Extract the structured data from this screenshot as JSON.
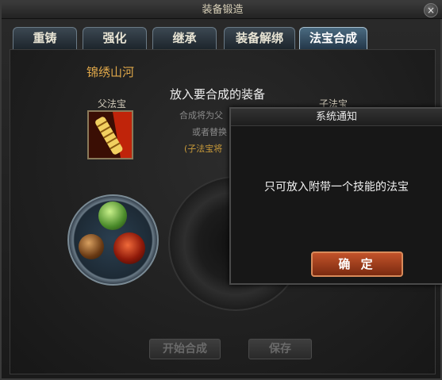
{
  "window": {
    "title": "装备锻造",
    "close_label": "×"
  },
  "tabs": [
    {
      "label": "重铸",
      "active": false
    },
    {
      "label": "强化",
      "active": false
    },
    {
      "label": "继承",
      "active": false
    },
    {
      "label": "装备解绑",
      "active": false
    },
    {
      "label": "法宝合成",
      "active": true
    }
  ],
  "main": {
    "item_name": "锦绣山河",
    "prompt_title": "放入要合成的装备",
    "hint_line1": "合成将为父",
    "hint_line2": "或者替换",
    "hint_line3": "(子法宝将",
    "parent_label": "父法宝",
    "child_label": "子法宝",
    "start_button": "开始合成",
    "save_button": "保存"
  },
  "dialog": {
    "title": "系统通知",
    "message": "只可放入附带一个技能的法宝",
    "ok_button": "确 定"
  },
  "colors": {
    "accent_gold": "#e0a84a",
    "ok_button": "#b8472a",
    "orb_green": "#7ab84a",
    "orb_brown": "#8a5a2a",
    "orb_red": "#b02a1a"
  }
}
